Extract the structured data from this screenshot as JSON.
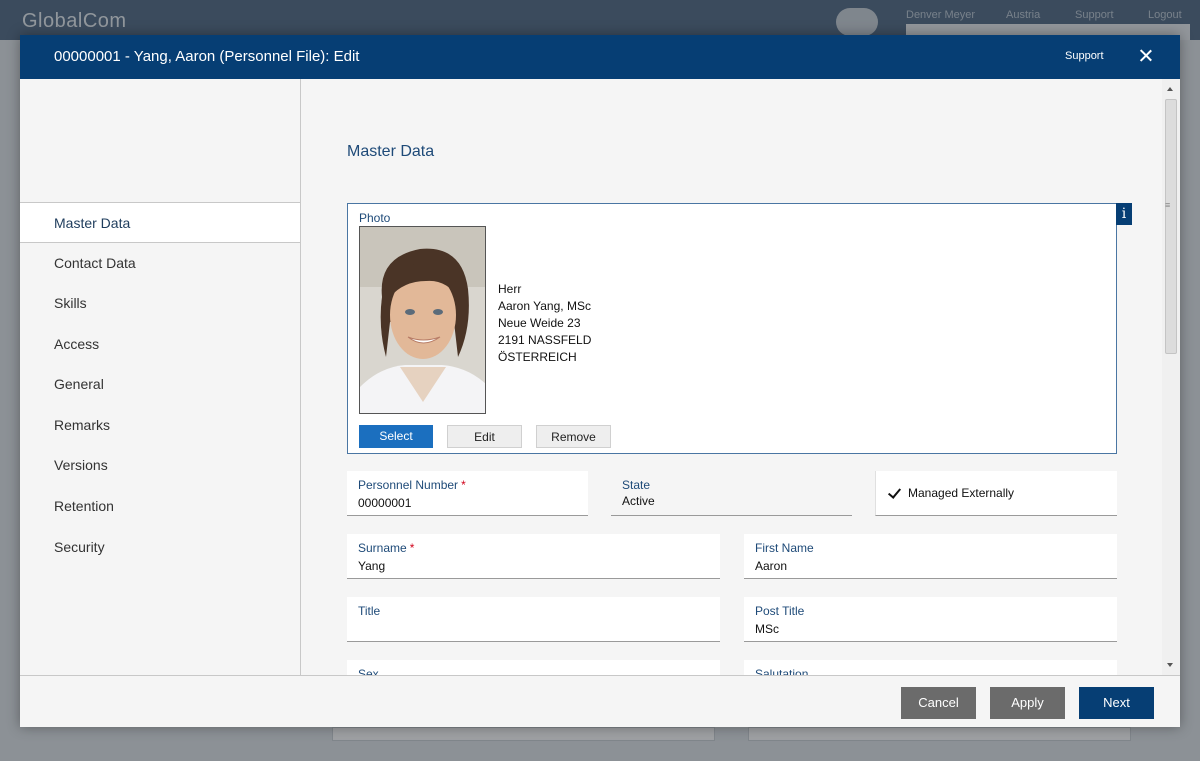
{
  "background": {
    "logo": "GlobalCom",
    "links": [
      "Denver Meyer",
      "Austria",
      "Support",
      "Logout"
    ]
  },
  "dialog": {
    "title": "00000001 - Yang, Aaron (Personnel File): Edit",
    "support_label": "Support",
    "close_icon": "close-icon"
  },
  "sidebar": {
    "items": [
      {
        "label": "Master Data",
        "active": true
      },
      {
        "label": "Contact Data",
        "active": false
      },
      {
        "label": "Skills",
        "active": false
      },
      {
        "label": "Access",
        "active": false
      },
      {
        "label": "General",
        "active": false
      },
      {
        "label": "Remarks",
        "active": false
      },
      {
        "label": "Versions",
        "active": false
      },
      {
        "label": "Retention",
        "active": false
      },
      {
        "label": "Security",
        "active": false
      }
    ]
  },
  "main": {
    "section_title": "Master Data",
    "photo": {
      "label": "Photo",
      "info_glyph": "i",
      "address": [
        "Herr",
        "Aaron Yang, MSc",
        "Neue Weide 23",
        "2191 NASSFELD",
        "ÖSTERREICH"
      ],
      "buttons": {
        "select": "Select",
        "edit": "Edit",
        "remove": "Remove"
      }
    },
    "fields": {
      "personnel_number": {
        "label": "Personnel Number",
        "required": "*",
        "value": "00000001"
      },
      "state": {
        "label": "State",
        "value": "Active"
      },
      "managed_externally": {
        "label": "Managed Externally",
        "checked": true
      },
      "surname": {
        "label": "Surname",
        "required": "*",
        "value": "Yang"
      },
      "first_name": {
        "label": "First Name",
        "value": "Aaron"
      },
      "title": {
        "label": "Title",
        "value": ""
      },
      "post_title": {
        "label": "Post Title",
        "value": "MSc"
      },
      "sex": {
        "label": "Sex",
        "value": ""
      },
      "salutation": {
        "label": "Salutation",
        "value": ""
      }
    }
  },
  "footer": {
    "cancel": "Cancel",
    "apply": "Apply",
    "next": "Next"
  },
  "colors": {
    "header": "#063e74",
    "primary_button": "#1b6fbf",
    "secondary_button": "#6b6b6b",
    "label": "#1e4a78",
    "required": "#d0021b"
  }
}
